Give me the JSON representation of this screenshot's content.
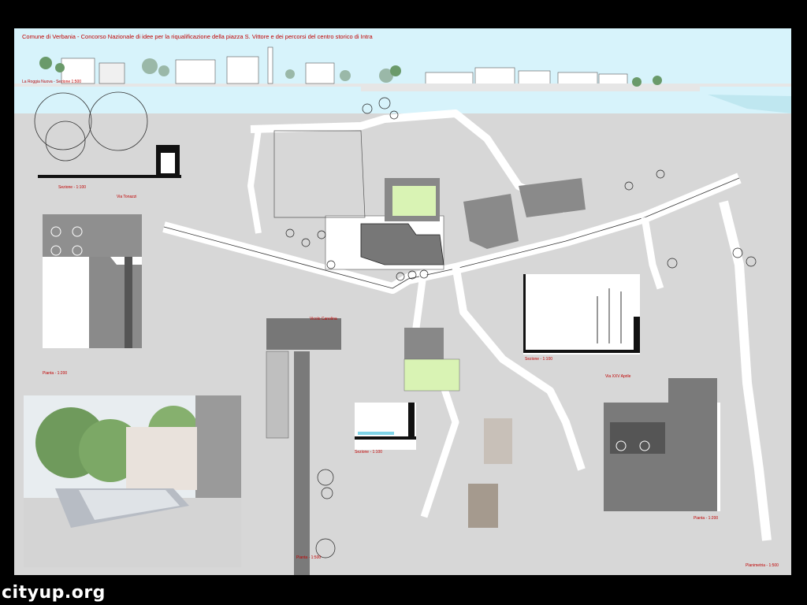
{
  "header": {
    "title": "Comune di Verbania - Concorso Nazionale di idee per la riqualificazione della piazza S. Vittore e dei percorsi del centro storico di Intra",
    "elevation_label": "La Roggia Nuova - Sezione 1:500"
  },
  "labels": {
    "sezione_1_100_a": "Sezione - 1:100",
    "via_tonazzi": "Via Tonazzi",
    "pianta_a": "Pianta - 1:200",
    "vicolo": "Vicolo Canolina",
    "sezione_1_100_b": "Sezione - 1:100",
    "sezione_1_100_c": "Sezione - 1:100",
    "via_xxv": "Via XXV Aprile",
    "pianta_b": "Pianta - 1:500",
    "pianta_c": "Pianta - 1:200",
    "planimetria": "Planimetria - 1:500"
  },
  "watermark": "cityup.org",
  "colors": {
    "board": "#d7d7d7",
    "sky": "#d7f3fb",
    "road": "#ffffff",
    "building": "#808080",
    "label_red": "#c00000",
    "green_patch": "#d9f3b4"
  }
}
